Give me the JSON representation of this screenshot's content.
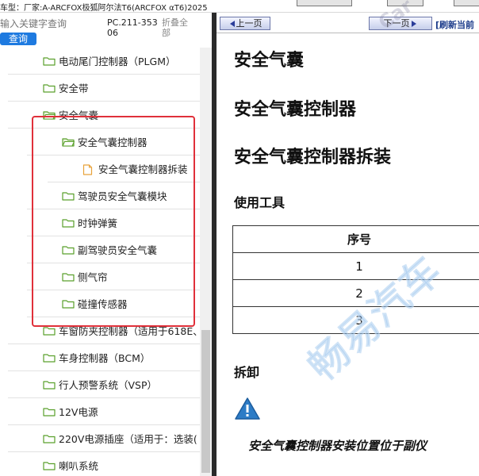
{
  "window": {
    "title": "车型：厂家:A-ARCFOX极狐阿尔法T6(ARCFOX αT6)2025"
  },
  "search": {
    "placeholder": "输入关键字查询",
    "button_label": "查询",
    "pc_code": "PC.211-35306",
    "collapse_all": "折叠全部"
  },
  "tree": {
    "items": [
      {
        "label": "电动尾门控制器（PLGM）",
        "type": "folder"
      },
      {
        "label": "安全带",
        "type": "folder"
      },
      {
        "label": "安全气囊",
        "type": "folder-open"
      },
      {
        "label": "安全气囊控制器",
        "type": "folder-open"
      },
      {
        "label": "安全气囊控制器拆装",
        "type": "document"
      },
      {
        "label": "驾驶员安全气囊模块",
        "type": "folder"
      },
      {
        "label": "时钟弹簧",
        "type": "folder"
      },
      {
        "label": "副驾驶员安全气囊",
        "type": "folder"
      },
      {
        "label": "侧气帘",
        "type": "folder"
      },
      {
        "label": "碰撞传感器",
        "type": "folder"
      },
      {
        "label": "车窗防夹控制器（适用于618E、",
        "type": "folder"
      },
      {
        "label": "车身控制器（BCM）",
        "type": "folder"
      },
      {
        "label": "行人预警系统（VSP）",
        "type": "folder"
      },
      {
        "label": "12V电源",
        "type": "folder"
      },
      {
        "label": "220V电源插座（适用于：选装(",
        "type": "folder"
      },
      {
        "label": "喇叭系统",
        "type": "folder"
      }
    ]
  },
  "nav": {
    "prev_label": "上一页",
    "next_label": "下一页",
    "refresh_label": "[刷新当前"
  },
  "document": {
    "heading1": "安全气囊",
    "heading2": "安全气囊控制器",
    "heading3": "安全气囊控制器拆装",
    "tools_heading": "使用工具",
    "table_header": "序号",
    "table_rows": [
      "1",
      "2",
      "3"
    ],
    "removal_heading": "拆卸",
    "body_text": "安全气囊控制器安装位置位于副仪"
  },
  "watermark": {
    "main": "畅易汽车",
    "small": "Car"
  },
  "colors": {
    "highlight_border": "#e0303a",
    "search_button": "#1e7ae0",
    "folder_green": "#5aa02c",
    "document_orange": "#e8a23a",
    "warning_blue": "#2d7cc6"
  }
}
